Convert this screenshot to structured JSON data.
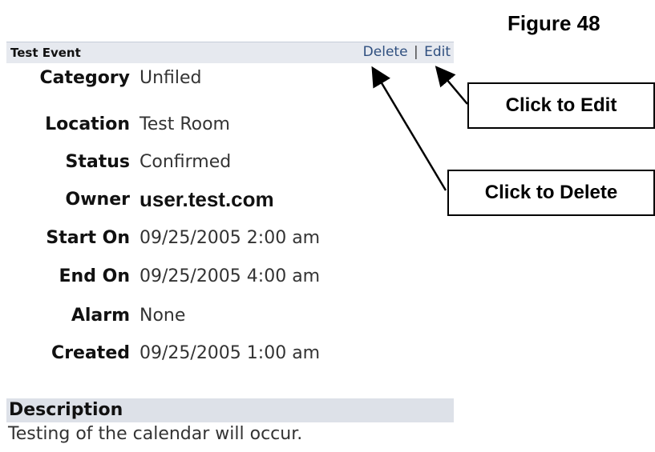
{
  "figure_label": "Figure 48",
  "event": {
    "title": "Test Event",
    "delete_label": "Delete",
    "separator": "|",
    "edit_label": "Edit"
  },
  "fields": [
    {
      "label": "Category",
      "value": "Unfiled"
    },
    {
      "label": "Location",
      "value": "Test Room"
    },
    {
      "label": "Status",
      "value": "Confirmed"
    },
    {
      "label": "Owner",
      "value": "user.test.com"
    },
    {
      "label": "Start On",
      "value": "09/25/2005 2:00 am"
    },
    {
      "label": "End On",
      "value": "09/25/2005 4:00 am"
    },
    {
      "label": "Alarm",
      "value": "None"
    },
    {
      "label": "Created",
      "value": "09/25/2005 1:00 am"
    }
  ],
  "description": {
    "heading": "Description",
    "text": "Testing of the calendar will occur."
  },
  "callouts": {
    "edit": "Click to Edit",
    "delete": "Click to Delete"
  },
  "colors": {
    "header_bg": "#e6e9ef",
    "link": "#2f4f7f",
    "description_bg": "#dde1e8"
  }
}
